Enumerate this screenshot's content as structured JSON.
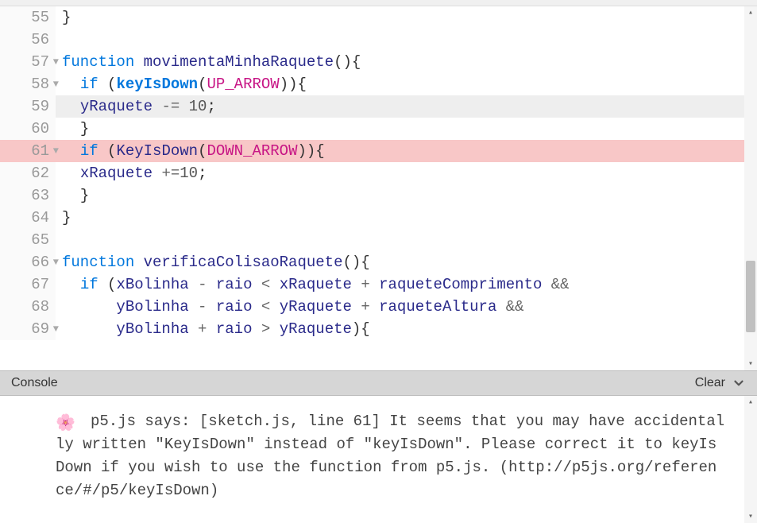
{
  "editor": {
    "lines": [
      {
        "num": 55,
        "fold": false,
        "highlight": "",
        "tokens": [
          {
            "t": "punct",
            "v": "}"
          }
        ]
      },
      {
        "num": 56,
        "fold": false,
        "highlight": "",
        "tokens": []
      },
      {
        "num": 57,
        "fold": true,
        "highlight": "",
        "tokens": [
          {
            "t": "kw",
            "v": "function"
          },
          {
            "t": "sp",
            "v": " "
          },
          {
            "t": "fn",
            "v": "movimentaMinhaRaquete"
          },
          {
            "t": "punct",
            "v": "(){"
          }
        ]
      },
      {
        "num": 58,
        "fold": true,
        "highlight": "",
        "tokens": [
          {
            "t": "sp",
            "v": "  "
          },
          {
            "t": "kw",
            "v": "if"
          },
          {
            "t": "sp",
            "v": " "
          },
          {
            "t": "punct",
            "v": "("
          },
          {
            "t": "call",
            "v": "keyIsDown"
          },
          {
            "t": "punct",
            "v": "("
          },
          {
            "t": "const",
            "v": "UP_ARROW"
          },
          {
            "t": "punct",
            "v": ")){"
          }
        ]
      },
      {
        "num": 59,
        "fold": false,
        "highlight": "gray",
        "tokens": [
          {
            "t": "sp",
            "v": "  "
          },
          {
            "t": "var",
            "v": "yRaquete"
          },
          {
            "t": "sp",
            "v": " "
          },
          {
            "t": "op",
            "v": "-="
          },
          {
            "t": "sp",
            "v": " "
          },
          {
            "t": "num",
            "v": "10"
          },
          {
            "t": "punct",
            "v": ";"
          }
        ]
      },
      {
        "num": 60,
        "fold": false,
        "highlight": "",
        "tokens": [
          {
            "t": "sp",
            "v": "  "
          },
          {
            "t": "punct",
            "v": "}"
          }
        ]
      },
      {
        "num": 61,
        "fold": true,
        "highlight": "pink",
        "tokens": [
          {
            "t": "sp",
            "v": "  "
          },
          {
            "t": "kw",
            "v": "if"
          },
          {
            "t": "sp",
            "v": " "
          },
          {
            "t": "punct",
            "v": "("
          },
          {
            "t": "err-call",
            "v": "KeyIsDown"
          },
          {
            "t": "punct",
            "v": "("
          },
          {
            "t": "const",
            "v": "DOWN_ARROW"
          },
          {
            "t": "punct",
            "v": ")){"
          }
        ]
      },
      {
        "num": 62,
        "fold": false,
        "highlight": "",
        "tokens": [
          {
            "t": "sp",
            "v": "  "
          },
          {
            "t": "var",
            "v": "xRaquete"
          },
          {
            "t": "sp",
            "v": " "
          },
          {
            "t": "op",
            "v": "+="
          },
          {
            "t": "num",
            "v": "10"
          },
          {
            "t": "punct",
            "v": ";"
          }
        ]
      },
      {
        "num": 63,
        "fold": false,
        "highlight": "",
        "tokens": [
          {
            "t": "sp",
            "v": "  "
          },
          {
            "t": "punct",
            "v": "}"
          }
        ]
      },
      {
        "num": 64,
        "fold": false,
        "highlight": "",
        "tokens": [
          {
            "t": "punct",
            "v": "}"
          }
        ]
      },
      {
        "num": 65,
        "fold": false,
        "highlight": "",
        "tokens": []
      },
      {
        "num": 66,
        "fold": true,
        "highlight": "",
        "tokens": [
          {
            "t": "kw",
            "v": "function"
          },
          {
            "t": "sp",
            "v": " "
          },
          {
            "t": "fn",
            "v": "verificaColisaoRaquete"
          },
          {
            "t": "punct",
            "v": "(){"
          }
        ]
      },
      {
        "num": 67,
        "fold": false,
        "highlight": "",
        "tokens": [
          {
            "t": "sp",
            "v": "  "
          },
          {
            "t": "kw",
            "v": "if"
          },
          {
            "t": "sp",
            "v": " "
          },
          {
            "t": "punct",
            "v": "("
          },
          {
            "t": "var",
            "v": "xBolinha"
          },
          {
            "t": "sp",
            "v": " "
          },
          {
            "t": "op",
            "v": "-"
          },
          {
            "t": "sp",
            "v": " "
          },
          {
            "t": "var",
            "v": "raio"
          },
          {
            "t": "sp",
            "v": " "
          },
          {
            "t": "op",
            "v": "<"
          },
          {
            "t": "sp",
            "v": " "
          },
          {
            "t": "var",
            "v": "xRaquete"
          },
          {
            "t": "sp",
            "v": " "
          },
          {
            "t": "op",
            "v": "+"
          },
          {
            "t": "sp",
            "v": " "
          },
          {
            "t": "var",
            "v": "raqueteComprimento"
          },
          {
            "t": "sp",
            "v": " "
          },
          {
            "t": "op",
            "v": "&&"
          }
        ]
      },
      {
        "num": 68,
        "fold": false,
        "highlight": "",
        "tokens": [
          {
            "t": "sp",
            "v": "      "
          },
          {
            "t": "var",
            "v": "yBolinha"
          },
          {
            "t": "sp",
            "v": " "
          },
          {
            "t": "op",
            "v": "-"
          },
          {
            "t": "sp",
            "v": " "
          },
          {
            "t": "var",
            "v": "raio"
          },
          {
            "t": "sp",
            "v": " "
          },
          {
            "t": "op",
            "v": "<"
          },
          {
            "t": "sp",
            "v": " "
          },
          {
            "t": "var",
            "v": "yRaquete"
          },
          {
            "t": "sp",
            "v": " "
          },
          {
            "t": "op",
            "v": "+"
          },
          {
            "t": "sp",
            "v": " "
          },
          {
            "t": "var",
            "v": "raqueteAltura"
          },
          {
            "t": "sp",
            "v": " "
          },
          {
            "t": "op",
            "v": "&&"
          }
        ]
      },
      {
        "num": 69,
        "fold": true,
        "highlight": "",
        "tokens": [
          {
            "t": "sp",
            "v": "      "
          },
          {
            "t": "var",
            "v": "yBolinha"
          },
          {
            "t": "sp",
            "v": " "
          },
          {
            "t": "op",
            "v": "+"
          },
          {
            "t": "sp",
            "v": " "
          },
          {
            "t": "var",
            "v": "raio"
          },
          {
            "t": "sp",
            "v": " "
          },
          {
            "t": "op",
            "v": ">"
          },
          {
            "t": "sp",
            "v": " "
          },
          {
            "t": "var",
            "v": "yRaquete"
          },
          {
            "t": "punct",
            "v": "){"
          }
        ]
      }
    ]
  },
  "console": {
    "title": "Console",
    "clear_label": "Clear",
    "icon": "🌸",
    "message": "p5.js says: [sketch.js, line 61] It seems that you may have accidentally written \"KeyIsDown\" instead of \"keyIsDown\". Please correct it to keyIsDown if you wish to use the function from p5.js. (http://p5js.org/reference/#/p5/keyIsDown)"
  }
}
